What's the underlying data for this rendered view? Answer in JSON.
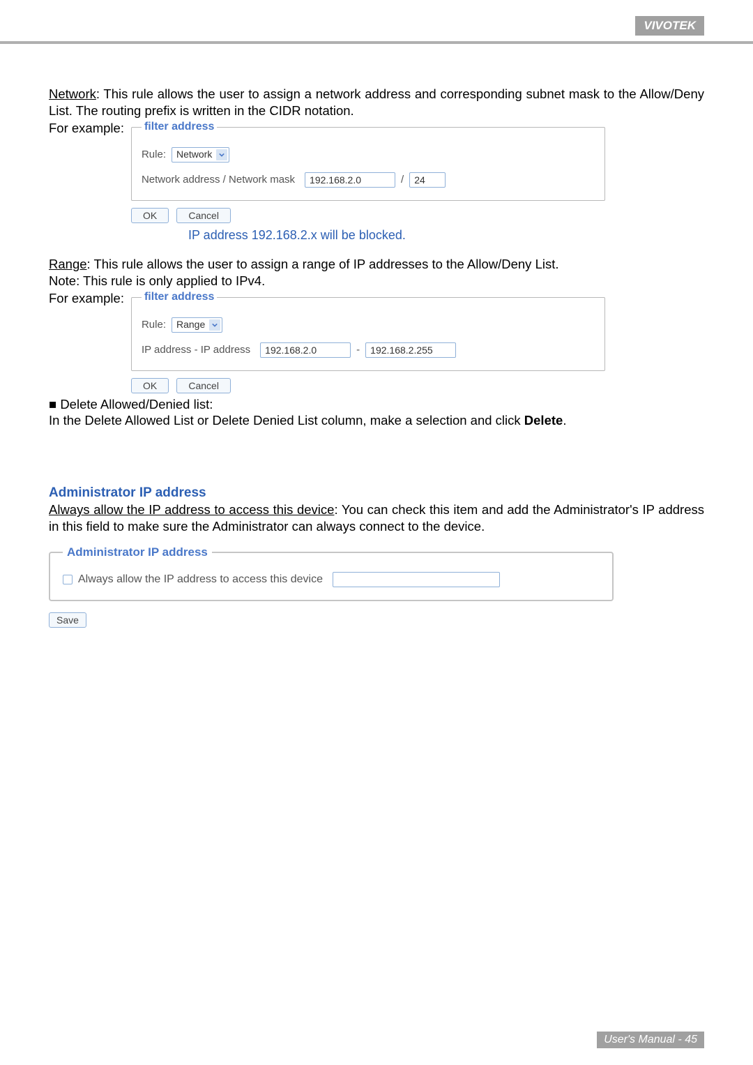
{
  "header": {
    "brand": "VIVOTEK"
  },
  "network": {
    "label": "Network",
    "desc_after": ": This rule allows the user to assign a network address and corresponding subnet mask to the Allow/Deny List. The routing prefix is written in the CIDR notation.",
    "for_example": "For example:",
    "fieldset_legend": "filter address",
    "rule_label": "Rule:",
    "rule_value": "Network",
    "addr_label": "Network address / Network mask",
    "ip_value": "192.168.2.0",
    "slash": "/",
    "mask_value": "24",
    "ok": "OK",
    "cancel": "Cancel",
    "caption": "IP address 192.168.2.x will be blocked."
  },
  "range": {
    "label": "Range",
    "desc_after": ": This rule allows the user to assign a range of IP addresses to the Allow/Deny List.",
    "note": "Note: This rule is only applied to IPv4.",
    "for_example": "For example:",
    "fieldset_legend": "filter address",
    "rule_label": "Rule:",
    "rule_value": "Range",
    "addr_label": "IP address - IP address",
    "ip_from": "192.168.2.0",
    "dash": "-",
    "ip_to": "192.168.2.255",
    "ok": "OK",
    "cancel": "Cancel"
  },
  "delete_section": {
    "bullet": "■ Delete Allowed/Denied list:",
    "text_before_bold": "In the Delete Allowed List or Delete Denied List column, make a selection and click ",
    "bold": "Delete",
    "text_after_bold": "."
  },
  "admin": {
    "title": "Administrator IP address",
    "underline": "Always allow the IP address to access this device",
    "desc_after": ": You can check this item and add the Administrator's IP address in this field to make sure the Administrator can always connect to the device.",
    "fieldset_legend": "Administrator IP address",
    "checkbox_label": "Always allow the IP address to access this device",
    "ip_value": "",
    "save": "Save"
  },
  "footer": {
    "text": "User's Manual - 45"
  }
}
